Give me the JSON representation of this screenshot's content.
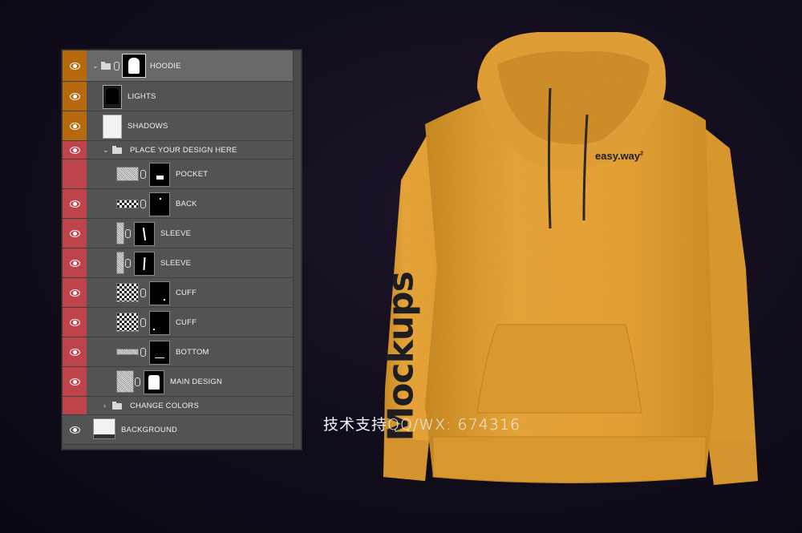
{
  "colors": {
    "background": "#120d1c",
    "panel": "#535353",
    "selected_row": "#696969",
    "visibility_orange": "#b6690f",
    "visibility_red": "#bf434b",
    "hoodie": "#e6a235",
    "print": "#1e1e22"
  },
  "layers_panel": {
    "layers": [
      {
        "name": "HOODIE",
        "type": "group",
        "expanded": true,
        "selected": true,
        "visible": true,
        "color": "orange"
      },
      {
        "name": "LIGHTS",
        "type": "layer",
        "visible": true,
        "color": "orange"
      },
      {
        "name": "SHADOWS",
        "type": "layer",
        "visible": true,
        "color": "orange"
      },
      {
        "name": "PLACE YOUR DESIGN HERE",
        "type": "group",
        "expanded": true,
        "visible": true,
        "color": "red"
      },
      {
        "name": "POCKET",
        "type": "smart-object",
        "visible": false,
        "color": "red"
      },
      {
        "name": "BACK",
        "type": "smart-object",
        "visible": true,
        "color": "red"
      },
      {
        "name": "SLEEVE",
        "type": "smart-object",
        "visible": true,
        "color": "red"
      },
      {
        "name": "SLEEVE",
        "type": "smart-object",
        "visible": true,
        "color": "red"
      },
      {
        "name": "CUFF",
        "type": "smart-object",
        "visible": true,
        "color": "red"
      },
      {
        "name": "CUFF",
        "type": "smart-object",
        "visible": true,
        "color": "red"
      },
      {
        "name": "BOTTOM",
        "type": "smart-object",
        "visible": true,
        "color": "red"
      },
      {
        "name": "MAIN DESIGN",
        "type": "smart-object",
        "visible": true,
        "color": "red"
      },
      {
        "name": "CHANGE COLORS",
        "type": "group",
        "expanded": false,
        "visible": false,
        "color": "red"
      },
      {
        "name": "BACKGROUND",
        "type": "layer",
        "visible": true,
        "color": "none"
      }
    ]
  },
  "mockup": {
    "chest_logo": "easy.way",
    "chest_logo_superscript": "2",
    "sleeve_print": "Mockups"
  },
  "watermark": "技术支持QQ/WX: 674316"
}
